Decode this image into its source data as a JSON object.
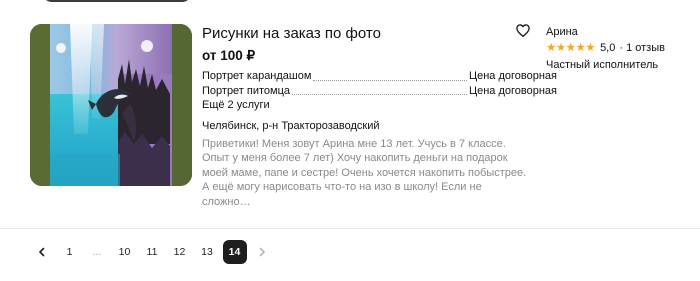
{
  "listing": {
    "title": "Рисунки на заказ по фото",
    "price": "от 100 ₽",
    "services": [
      {
        "name": "Портрет карандашом",
        "price": "Цена договорная"
      },
      {
        "name": "Портрет питомца",
        "price": "Цена договорная"
      }
    ],
    "more_services": "Ещё 2 услуги",
    "location": "Челябинск, р-н Тракторозаводский",
    "description": "Приветики! Меня зовут Арина мне 13 лет. Учусь в 7 классе. Опыт у меня более 7 лет) Хочу накопить деньги на подарок моей маме, папе и сестре! Очень хочется накопить побыстрее. А ещё могу нарисовать что-то на изо в школу! Если не сложно…",
    "favorite_icon": "heart-outline-icon"
  },
  "seller": {
    "name": "Арина",
    "rating_value": "5,0",
    "reviews": "· 1 отзыв",
    "type": "Частный исполнитель",
    "stars": 5,
    "star_color": "#f5a623"
  },
  "pagination": {
    "prev_icon": "chevron-left-icon",
    "next_icon": "chevron-right-icon",
    "pages": [
      "1",
      "...",
      "10",
      "11",
      "12",
      "13",
      "14"
    ],
    "active": "14"
  }
}
